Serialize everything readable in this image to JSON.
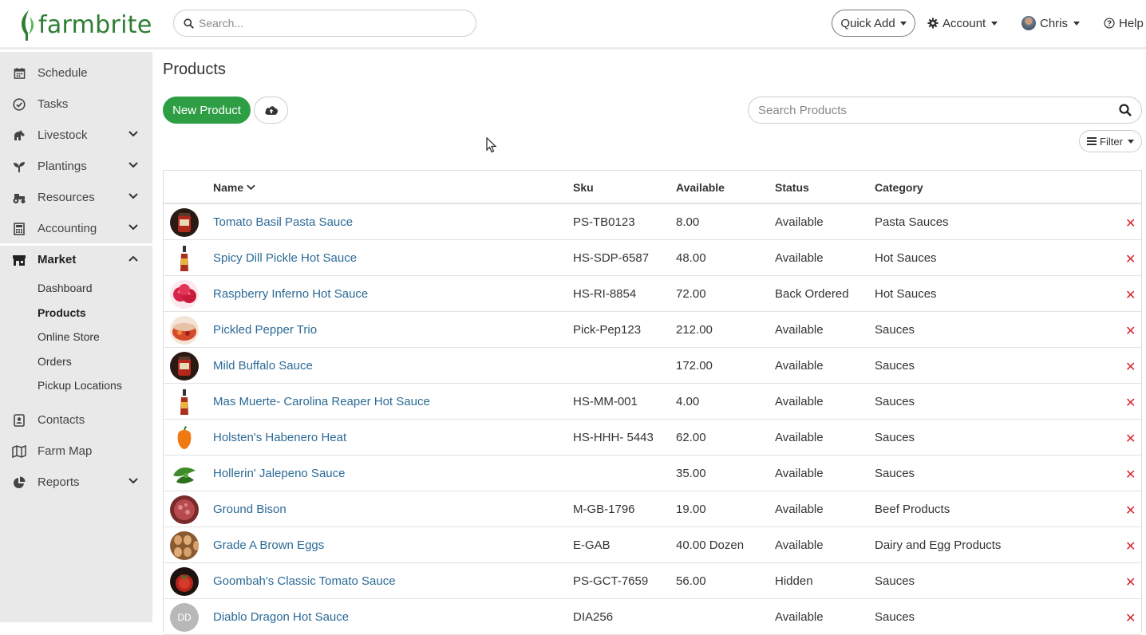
{
  "brand": {
    "name": "farmbrite",
    "color": "#2e7d32"
  },
  "header": {
    "search_placeholder": "Search...",
    "quick_add": "Quick Add",
    "account": "Account",
    "user": "Chris",
    "help": "Help"
  },
  "sidebar": {
    "items": [
      {
        "label": "Schedule",
        "icon": "calendar-icon"
      },
      {
        "label": "Tasks",
        "icon": "check-circle-icon"
      },
      {
        "label": "Livestock",
        "icon": "horse-icon"
      },
      {
        "label": "Plantings",
        "icon": "seedling-icon"
      },
      {
        "label": "Resources",
        "icon": "tractor-icon"
      },
      {
        "label": "Accounting",
        "icon": "calculator-icon"
      },
      {
        "label": "Market",
        "icon": "store-icon"
      },
      {
        "label": "Contacts",
        "icon": "address-book-icon"
      },
      {
        "label": "Farm Map",
        "icon": "map-icon"
      },
      {
        "label": "Reports",
        "icon": "pie-chart-icon"
      }
    ],
    "market_sub": [
      "Dashboard",
      "Products",
      "Online Store",
      "Orders",
      "Pickup Locations"
    ]
  },
  "page": {
    "title": "Products",
    "new_button": "New Product",
    "search_placeholder": "Search Products",
    "filter": "Filter"
  },
  "table": {
    "headers": {
      "name": "Name",
      "sku": "Sku",
      "available": "Available",
      "status": "Status",
      "category": "Category"
    },
    "rows": [
      {
        "name": "Tomato Basil Pasta Sauce",
        "sku": "PS-TB0123",
        "available": "8.00",
        "status": "Available",
        "category": "Pasta Sauces",
        "thumb": "jar-red"
      },
      {
        "name": "Spicy Dill Pickle Hot Sauce",
        "sku": "HS-SDP-6587",
        "available": "48.00",
        "status": "Available",
        "category": "Hot Sauces",
        "thumb": "bottle"
      },
      {
        "name": "Raspberry Inferno Hot Sauce",
        "sku": "HS-RI-8854",
        "available": "72.00",
        "status": "Back Ordered",
        "category": "Hot Sauces",
        "thumb": "raspberry"
      },
      {
        "name": "Pickled Pepper Trio",
        "sku": "Pick-Pep123",
        "available": "212.00",
        "status": "Available",
        "category": "Sauces",
        "thumb": "jar-peppers"
      },
      {
        "name": "Mild Buffalo Sauce",
        "sku": "",
        "available": "172.00",
        "status": "Available",
        "category": "Sauces",
        "thumb": "jar-red"
      },
      {
        "name": "Mas Muerte- Carolina Reaper Hot Sauce",
        "sku": "HS-MM-001",
        "available": "4.00",
        "status": "Available",
        "category": "Sauces",
        "thumb": "bottle"
      },
      {
        "name": "Holsten's Habenero Heat",
        "sku": "HS-HHH- 5443",
        "available": "62.00",
        "status": "Available",
        "category": "Sauces",
        "thumb": "habanero"
      },
      {
        "name": "Hollerin' Jalepeno Sauce",
        "sku": "",
        "available": "35.00",
        "status": "Available",
        "category": "Sauces",
        "thumb": "jalapeno"
      },
      {
        "name": "Ground Bison",
        "sku": "M-GB-1796",
        "available": "19.00",
        "status": "Available",
        "category": "Beef Products",
        "thumb": "meat"
      },
      {
        "name": "Grade A Brown Eggs",
        "sku": "E-GAB",
        "available": "40.00 Dozen",
        "status": "Available",
        "category": "Dairy and Egg Products",
        "thumb": "eggs"
      },
      {
        "name": "Goombah's Classic Tomato Sauce",
        "sku": "PS-GCT-7659",
        "available": "56.00",
        "status": "Hidden",
        "category": "Sauces",
        "thumb": "tomato"
      },
      {
        "name": "Diablo Dragon Hot Sauce",
        "sku": "DIA256",
        "available": "",
        "status": "Available",
        "category": "Sauces",
        "thumb": "initials",
        "initials": "DD"
      }
    ]
  }
}
